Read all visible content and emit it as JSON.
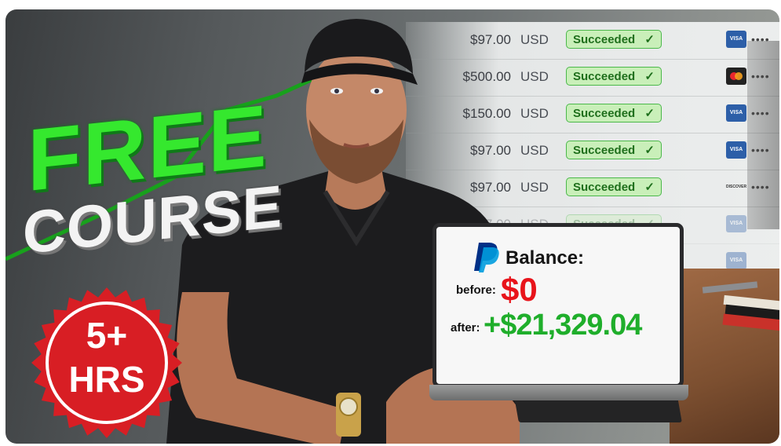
{
  "headline": {
    "line1": "FREE",
    "line2": "COURSE"
  },
  "seal": {
    "line1": "5+",
    "line2": "HRS"
  },
  "payments": [
    {
      "amount": "$97.00",
      "currency": "USD",
      "status": "Succeeded",
      "card": "visa",
      "card_label": "VISA",
      "masked": "••••"
    },
    {
      "amount": "$500.00",
      "currency": "USD",
      "status": "Succeeded",
      "card": "mastercard",
      "card_label": "",
      "masked": "••••"
    },
    {
      "amount": "$150.00",
      "currency": "USD",
      "status": "Succeeded",
      "card": "visa",
      "card_label": "VISA",
      "masked": "••••"
    },
    {
      "amount": "$97.00",
      "currency": "USD",
      "status": "Succeeded",
      "card": "visa",
      "card_label": "VISA",
      "masked": "••••"
    },
    {
      "amount": "$97.00",
      "currency": "USD",
      "status": "Succeeded",
      "card": "discover",
      "card_label": "DISCOVER",
      "masked": "••••"
    },
    {
      "amount": "$97.00",
      "currency": "USD",
      "status": "Succeeded",
      "card": "visa",
      "card_label": "VISA",
      "masked": ""
    },
    {
      "amount": "",
      "currency": "",
      "status": "",
      "card": "visa",
      "card_label": "VISA",
      "masked": ""
    }
  ],
  "laptop": {
    "balance_label": "Balance:",
    "before_label": "before:",
    "before_value": "$0",
    "after_label": "after:",
    "after_value": "+$21,329.04"
  },
  "colors": {
    "free_green": "#35e82e",
    "seal_red": "#d81e24",
    "before_red": "#e8141b",
    "after_green": "#1fae2b",
    "paypal_dark": "#003087",
    "paypal_light": "#009cde"
  },
  "icons": [
    "paypal-logo-icon",
    "check-icon",
    "visa-card-icon",
    "mastercard-icon",
    "discover-card-icon"
  ]
}
